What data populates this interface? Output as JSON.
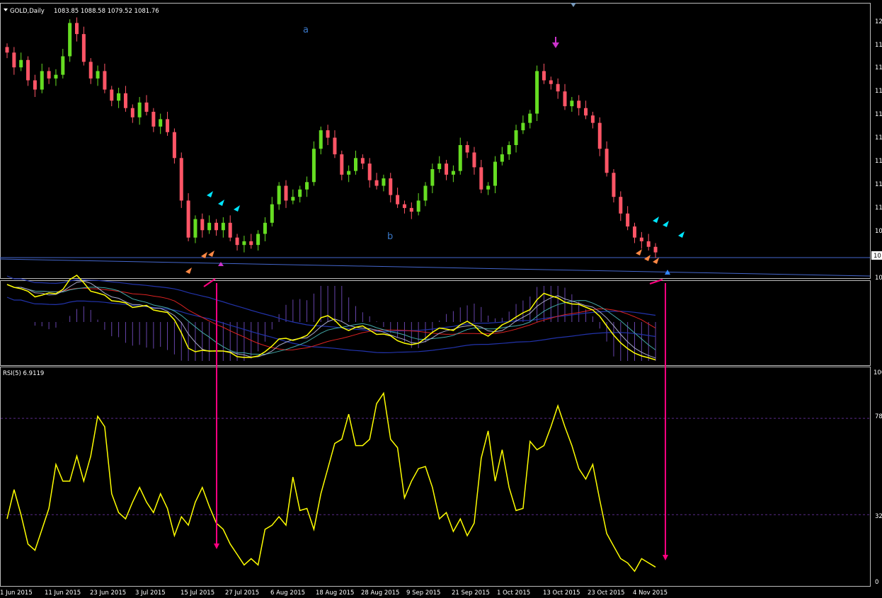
{
  "header": {
    "symbol_timeframe": "GOLD,Daily",
    "ohlc": "1083.85 1088.58 1079.52 1081.76"
  },
  "wave_labels": {
    "a": "a",
    "b": "b"
  },
  "rsi_header": "RSI(5) 6.9119",
  "price_axis_labels": [
    "12",
    "11",
    "11",
    "11",
    "11",
    "11",
    "11",
    "11",
    "11",
    "10",
    "10",
    "10"
  ],
  "rsi_axis_labels": [
    "100",
    "78",
    "32",
    "0"
  ],
  "date_labels": [
    "1 Jun 2015",
    "11 Jun 2015",
    "23 Jun 2015",
    "3 Jul 2015",
    "15 Jul 2015",
    "27 Jul 2015",
    "6 Aug 2015",
    "18 Aug 2015",
    "28 Aug 2015",
    "9 Sep 2015",
    "21 Sep 2015",
    "1 Oct 2015",
    "13 Oct 2015",
    "23 Oct 2015",
    "4 Nov 2015"
  ],
  "colors": {
    "bull_candle": "#66dd22",
    "bear_candle": "#ff5566",
    "rsi_line": "#ffff00",
    "divergence_arrow": "#ff0080",
    "signal_cyan": "#00e5ff",
    "signal_orange": "#ff8844",
    "grid_dash": "#5a2a8a"
  },
  "chart_data": [
    {
      "type": "candlestick",
      "title": "GOLD,Daily",
      "x_start": "1 Jun 2015",
      "close_path": [
        1190,
        1182,
        1186,
        1175,
        1170,
        1180,
        1176,
        1178,
        1188,
        1206,
        1200,
        1185,
        1176,
        1180,
        1170,
        1164,
        1168,
        1160,
        1155,
        1163,
        1158,
        1150,
        1154,
        1147,
        1133,
        1110,
        1090,
        1100,
        1094,
        1098,
        1094,
        1098,
        1090,
        1086,
        1088,
        1086,
        1092,
        1098,
        1108,
        1118,
        1110,
        1112,
        1116,
        1120,
        1138,
        1148,
        1144,
        1135,
        1124,
        1126,
        1133,
        1130,
        1121,
        1118,
        1122,
        1113,
        1108,
        1106,
        1104,
        1110,
        1118,
        1127,
        1130,
        1124,
        1126,
        1140,
        1136,
        1128,
        1116,
        1118,
        1131,
        1135,
        1140,
        1148,
        1152,
        1157,
        1180,
        1175,
        1173,
        1169,
        1161,
        1164,
        1160,
        1156,
        1152,
        1138,
        1125,
        1112,
        1103,
        1096,
        1090,
        1088,
        1085,
        1082
      ]
    },
    {
      "type": "line",
      "title": "RSI(5) 6.9119",
      "ylim": [
        0,
        100
      ],
      "levels": [
        78,
        32
      ],
      "series": [
        {
          "values": [
            30,
            44,
            32,
            18,
            15,
            25,
            35,
            56,
            48,
            48,
            60,
            48,
            60,
            79,
            74,
            42,
            33,
            30,
            38,
            45,
            38,
            33,
            42,
            35,
            22,
            31,
            27,
            38,
            45,
            36,
            28,
            25,
            18,
            13,
            8,
            11,
            8,
            25,
            27,
            31,
            27,
            50,
            34,
            35,
            25,
            42,
            54,
            66,
            68,
            80,
            65,
            65,
            68,
            85,
            90,
            68,
            64,
            40,
            48,
            54,
            55,
            45,
            30,
            33,
            24,
            30,
            22,
            28,
            59,
            72,
            48,
            63,
            45,
            34,
            35,
            67,
            63,
            65,
            74,
            84,
            74,
            65,
            54,
            49,
            56,
            39,
            23,
            17,
            11,
            9,
            5,
            11,
            9,
            7
          ]
        }
      ]
    }
  ]
}
